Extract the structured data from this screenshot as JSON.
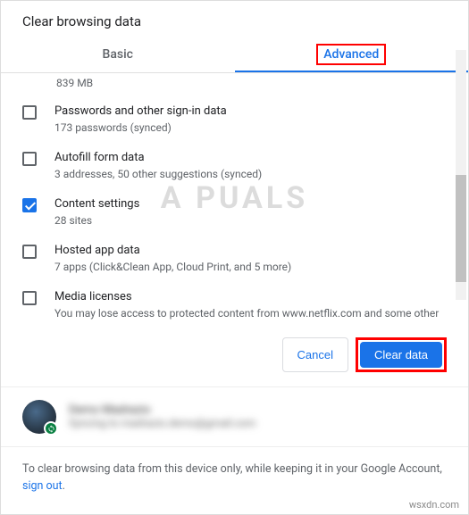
{
  "title": "Clear browsing data",
  "tabs": {
    "basic": "Basic",
    "advanced": "Advanced"
  },
  "truncated": "839 MB",
  "options": [
    {
      "title": "Passwords and other sign-in data",
      "desc": "173 passwords (synced)",
      "checked": false
    },
    {
      "title": "Autofill form data",
      "desc": "3 addresses, 50 other suggestions (synced)",
      "checked": false
    },
    {
      "title": "Content settings",
      "desc": "28 sites",
      "checked": true
    },
    {
      "title": "Hosted app data",
      "desc": "7 apps (Click&Clean App, Cloud Print, and 5 more)",
      "checked": false
    },
    {
      "title": "Media licenses",
      "desc": "You may lose access to protected content from www.netflix.com and some other sites.",
      "checked": false
    }
  ],
  "actions": {
    "cancel": "Cancel",
    "clear": "Clear data"
  },
  "account": {
    "name": "Demo Madrazio",
    "email": "Syncing to madrazio.demo@gmail.com"
  },
  "footer": {
    "text": "To clear browsing data from this device only, while keeping it in your Google Account, ",
    "link": "sign out"
  },
  "watermark": "A  PUALS",
  "credit": "wsxdn.com"
}
